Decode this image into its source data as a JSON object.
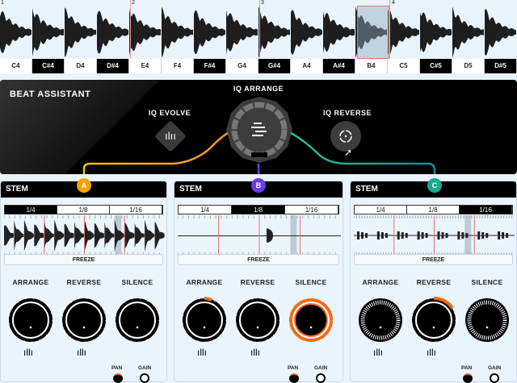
{
  "timeline": {
    "measures": [
      "1",
      "2",
      "3",
      "4"
    ],
    "keys": [
      {
        "label": "C4",
        "black": false
      },
      {
        "label": "C#4",
        "black": true
      },
      {
        "label": "D4",
        "black": false
      },
      {
        "label": "D#4",
        "black": true
      },
      {
        "label": "E4",
        "black": false
      },
      {
        "label": "F4",
        "black": false
      },
      {
        "label": "F#4",
        "black": true
      },
      {
        "label": "G4",
        "black": false
      },
      {
        "label": "G#4",
        "black": true
      },
      {
        "label": "A4",
        "black": false
      },
      {
        "label": "A#4",
        "black": true
      },
      {
        "label": "B4",
        "black": false
      },
      {
        "label": "C5",
        "black": false
      },
      {
        "label": "C#5",
        "black": true
      },
      {
        "label": "D5",
        "black": false
      },
      {
        "label": "D#5",
        "black": true
      }
    ],
    "selected_key": "B4"
  },
  "beat_assistant": {
    "title": "BEAT ASSISTANT",
    "evolve": "IQ EVOLVE",
    "arrange": "IQ ARRANGE",
    "reverse": "IQ REVERSE"
  },
  "colors": {
    "a": "#f2a300",
    "b": "#6a3de8",
    "c": "#1aa88f",
    "accent": "#f26a1b"
  },
  "stems": [
    {
      "title": "STEM",
      "badge": "A",
      "divisions": [
        "1/4",
        "1/8",
        "1/16"
      ],
      "active": 0,
      "freeze": "FREEZE",
      "knobs": [
        "ARRANGE",
        "REVERSE",
        "SILENCE"
      ],
      "pan": "PAN",
      "gain": "GAIN"
    },
    {
      "title": "STEM",
      "badge": "B",
      "divisions": [
        "1/4",
        "1/8",
        "1/16"
      ],
      "active": 1,
      "freeze": "FREEZE",
      "knobs": [
        "ARRANGE",
        "REVERSE",
        "SILENCE"
      ],
      "pan": "PAN",
      "gain": "GAIN"
    },
    {
      "title": "STEM",
      "badge": "C",
      "divisions": [
        "1/4",
        "1/8",
        "1/16"
      ],
      "active": 2,
      "freeze": "FREEZE",
      "knobs": [
        "ARRANGE",
        "REVERSE",
        "SILENCE"
      ],
      "pan": "PAN",
      "gain": "GAIN"
    }
  ]
}
